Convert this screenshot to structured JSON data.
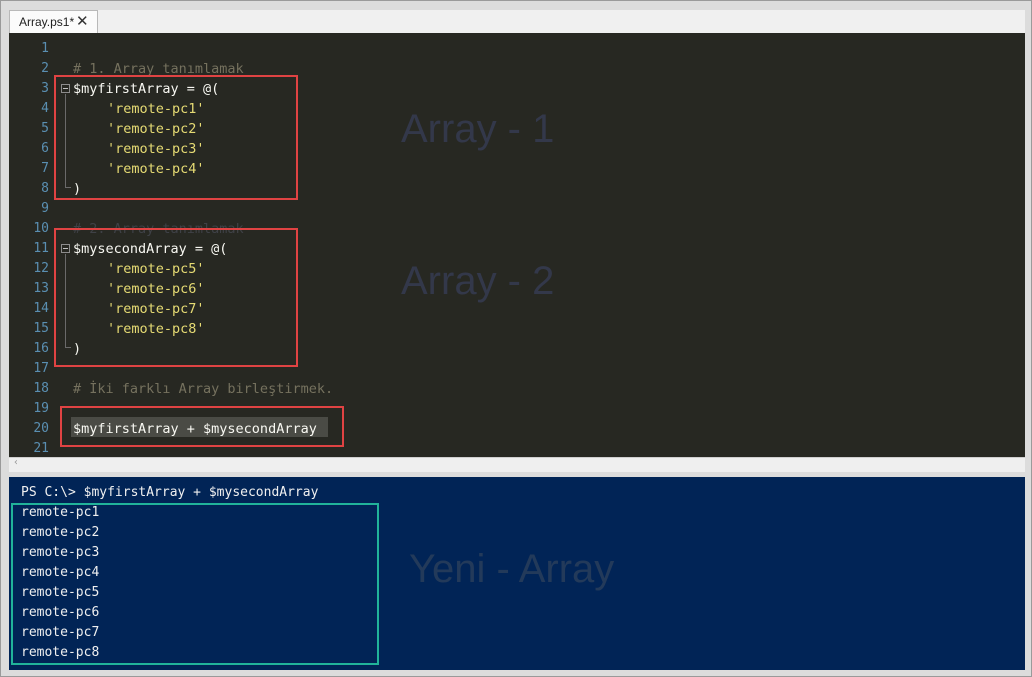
{
  "tab": {
    "title": "Array.ps1*",
    "close_icon": "close-icon"
  },
  "editor": {
    "line_numbers": [
      "1",
      "2",
      "3",
      "4",
      "5",
      "6",
      "7",
      "8",
      "9",
      "10",
      "11",
      "12",
      "13",
      "14",
      "15",
      "16",
      "17",
      "18",
      "19",
      "20",
      "21"
    ],
    "lines": {
      "l2": "# 1. Array tanımlamak",
      "l3_var": "$myfirstArray",
      "l3_rest": " = @(",
      "l4": "'remote-pc1'",
      "l5": "'remote-pc2'",
      "l6": "'remote-pc3'",
      "l7": "'remote-pc4'",
      "l8": ")",
      "l10": "# 2. Array tanımlamak",
      "l11_var": "$mysecondArray",
      "l11_rest": " = @(",
      "l12": "'remote-pc5'",
      "l13": "'remote-pc6'",
      "l14": "'remote-pc7'",
      "l15": "'remote-pc8'",
      "l16": ")",
      "l18": "# İki farklı Array birleştirmek.",
      "l20": "$myfirstArray + $mysecondArray"
    },
    "annotations": {
      "array1": "Array - 1",
      "array2": "Array - 2"
    }
  },
  "console": {
    "prompt_line": "PS C:\\> $myfirstArray + $mysecondArray",
    "output": [
      "remote-pc1",
      "remote-pc2",
      "remote-pc3",
      "remote-pc4",
      "remote-pc5",
      "remote-pc6",
      "remote-pc7",
      "remote-pc8"
    ],
    "annotation": "Yeni - Array"
  },
  "colors": {
    "editor_bg": "#272822",
    "console_bg": "#012456",
    "string": "#e6db74",
    "comment": "#75715e",
    "line_number": "#5a8fb2",
    "red_box": "#e04343",
    "teal_box": "#21b39a"
  }
}
